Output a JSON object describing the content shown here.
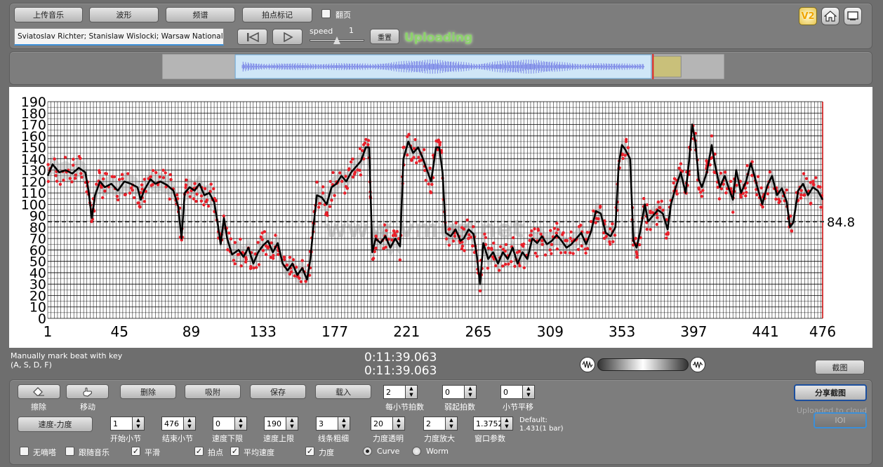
{
  "toolbar": {
    "upload_music": "上传音乐",
    "waveform": "波形",
    "spectrum": "频谱",
    "tap_mark": "拍点标记",
    "page_turn": "翻页",
    "track_title": "Sviatoslav Richter; Stanislaw Wislocki; Warsaw National Ph",
    "speed_label": "speed",
    "speed_value": "1",
    "speed_fraction": 0.5,
    "reset": "重置",
    "uploading": "Uploading",
    "version_badge": "V2"
  },
  "overview": {
    "selection_start": 0.13,
    "selection_end": 0.87,
    "marker_pos": 0.873
  },
  "chart_data": {
    "type": "line",
    "title": "",
    "xlabel": "",
    "ylabel": "",
    "xlim": [
      1,
      476
    ],
    "ylim": [
      0,
      190
    ],
    "xticks": [
      1,
      45,
      89,
      133,
      177,
      221,
      265,
      309,
      353,
      397,
      441,
      476
    ],
    "yticks": [
      0,
      10,
      20,
      30,
      40,
      50,
      60,
      70,
      80,
      90,
      100,
      110,
      120,
      130,
      140,
      150,
      160,
      170,
      180,
      190
    ],
    "average_line": 84.8,
    "average_label": "84.8",
    "grid": true,
    "watermark": "www.vmus.net",
    "series": [
      {
        "points": [
          [
            1,
            125
          ],
          [
            4,
            135
          ],
          [
            8,
            128
          ],
          [
            12,
            130
          ],
          [
            16,
            127
          ],
          [
            20,
            132
          ],
          [
            24,
            128
          ],
          [
            26,
            112
          ],
          [
            28,
            88
          ],
          [
            30,
            108
          ],
          [
            33,
            120
          ],
          [
            36,
            115
          ],
          [
            40,
            118
          ],
          [
            44,
            112
          ],
          [
            48,
            120
          ],
          [
            52,
            118
          ],
          [
            56,
            115
          ],
          [
            58,
            104
          ],
          [
            60,
            112
          ],
          [
            64,
            122
          ],
          [
            67,
            118
          ],
          [
            70,
            120
          ],
          [
            74,
            117
          ],
          [
            78,
            112
          ],
          [
            81,
            98
          ],
          [
            83,
            70
          ],
          [
            85,
            110
          ],
          [
            88,
            115
          ],
          [
            91,
            112
          ],
          [
            94,
            118
          ],
          [
            97,
            108
          ],
          [
            100,
            110
          ],
          [
            103,
            102
          ],
          [
            105,
            85
          ],
          [
            107,
            65
          ],
          [
            109,
            88
          ],
          [
            111,
            70
          ],
          [
            114,
            56
          ],
          [
            118,
            60
          ],
          [
            121,
            54
          ],
          [
            124,
            62
          ],
          [
            127,
            48
          ],
          [
            130,
            58
          ],
          [
            133,
            64
          ],
          [
            136,
            68
          ],
          [
            139,
            58
          ],
          [
            142,
            66
          ],
          [
            145,
            48
          ],
          [
            148,
            42
          ],
          [
            151,
            48
          ],
          [
            154,
            38
          ],
          [
            157,
            44
          ],
          [
            160,
            34
          ],
          [
            162,
            52
          ],
          [
            164,
            82
          ],
          [
            166,
            108
          ],
          [
            169,
            106
          ],
          [
            172,
            100
          ],
          [
            175,
            115
          ],
          [
            178,
            118
          ],
          [
            181,
            125
          ],
          [
            184,
            120
          ],
          [
            187,
            128
          ],
          [
            190,
            133
          ],
          [
            193,
            138
          ],
          [
            196,
            150
          ],
          [
            198,
            150
          ],
          [
            200,
            58
          ],
          [
            202,
            70
          ],
          [
            205,
            66
          ],
          [
            208,
            72
          ],
          [
            211,
            62
          ],
          [
            214,
            70
          ],
          [
            217,
            63
          ],
          [
            219,
            140
          ],
          [
            222,
            155
          ],
          [
            225,
            145
          ],
          [
            228,
            150
          ],
          [
            231,
            140
          ],
          [
            234,
            128
          ],
          [
            236,
            120
          ],
          [
            239,
            150
          ],
          [
            241,
            150
          ],
          [
            243,
            128
          ],
          [
            245,
            75
          ],
          [
            248,
            72
          ],
          [
            251,
            78
          ],
          [
            254,
            68
          ],
          [
            256,
            70
          ],
          [
            259,
            78
          ],
          [
            262,
            74
          ],
          [
            264,
            55
          ],
          [
            266,
            30
          ],
          [
            268,
            66
          ],
          [
            271,
            52
          ],
          [
            274,
            58
          ],
          [
            277,
            48
          ],
          [
            280,
            58
          ],
          [
            283,
            52
          ],
          [
            286,
            62
          ],
          [
            289,
            48
          ],
          [
            292,
            58
          ],
          [
            295,
            52
          ],
          [
            298,
            70
          ],
          [
            301,
            66
          ],
          [
            304,
            72
          ],
          [
            307,
            65
          ],
          [
            310,
            68
          ],
          [
            313,
            73
          ],
          [
            316,
            68
          ],
          [
            319,
            62
          ],
          [
            322,
            65
          ],
          [
            325,
            70
          ],
          [
            328,
            75
          ],
          [
            331,
            65
          ],
          [
            334,
            76
          ],
          [
            337,
            94
          ],
          [
            340,
            92
          ],
          [
            343,
            75
          ],
          [
            346,
            72
          ],
          [
            349,
            80
          ],
          [
            351,
            135
          ],
          [
            353,
            152
          ],
          [
            355,
            148
          ],
          [
            358,
            140
          ],
          [
            360,
            68
          ],
          [
            362,
            62
          ],
          [
            364,
            75
          ],
          [
            367,
            100
          ],
          [
            369,
            85
          ],
          [
            372,
            90
          ],
          [
            375,
            95
          ],
          [
            378,
            92
          ],
          [
            381,
            78
          ],
          [
            383,
            100
          ],
          [
            386,
            115
          ],
          [
            389,
            128
          ],
          [
            392,
            110
          ],
          [
            394,
            136
          ],
          [
            396,
            170
          ],
          [
            398,
            155
          ],
          [
            400,
            122
          ],
          [
            402,
            115
          ],
          [
            405,
            128
          ],
          [
            408,
            152
          ],
          [
            410,
            135
          ],
          [
            413,
            115
          ],
          [
            416,
            125
          ],
          [
            419,
            112
          ],
          [
            421,
            104
          ],
          [
            423,
            130
          ],
          [
            426,
            110
          ],
          [
            429,
            120
          ],
          [
            432,
            136
          ],
          [
            434,
            126
          ],
          [
            436,
            115
          ],
          [
            439,
            100
          ],
          [
            442,
            116
          ],
          [
            445,
            125
          ],
          [
            448,
            108
          ],
          [
            451,
            114
          ],
          [
            454,
            102
          ],
          [
            456,
            80
          ],
          [
            458,
            84
          ],
          [
            461,
            112
          ],
          [
            464,
            118
          ],
          [
            467,
            108
          ],
          [
            470,
            115
          ],
          [
            473,
            112
          ],
          [
            476,
            104
          ]
        ]
      }
    ]
  },
  "transport": {
    "hint_line1": "Manually mark beat with key",
    "hint_line2": "(A, S, D, F)",
    "time1": "0:11:39.063",
    "time2": "0:11:39.063",
    "screenshot": "截图"
  },
  "controls": {
    "erase": "擦除",
    "move": "移动",
    "delete": "删除",
    "absorb": "吸附",
    "save": "保存",
    "load": "载入",
    "beats_per_bar_label": "每小节拍数",
    "beats_per_bar_value": "2",
    "pickup_label": "弱起拍数",
    "pickup_value": "0",
    "bar_shift_label": "小节平移",
    "bar_shift_value": "0",
    "share_screenshot": "分享截图",
    "uploaded_to_cloud": "Uploaded to cloud",
    "ioi": "IOI",
    "tempo_dynamics": "速度-力度",
    "start_bar_label": "开始小节",
    "start_bar_value": "1",
    "end_bar_label": "结束小节",
    "end_bar_value": "476",
    "tempo_min_label": "速度下限",
    "tempo_min_value": "0",
    "tempo_max_label": "速度上限",
    "tempo_max_value": "190",
    "line_width_label": "线条粗细",
    "line_width_value": "3",
    "dyn_opacity_label": "力度透明",
    "dyn_opacity_value": "20",
    "dyn_zoom_label": "力度放大",
    "dyn_zoom_value": "2",
    "window_param_label": "窗口参数",
    "window_param_value": "1.3752",
    "default_line1": "Default:",
    "default_line2": "1.431(1 bar)",
    "no_beep": "无嘀嗒",
    "follow_music": "跟随音乐",
    "smooth": "平滑",
    "beat_points": "拍点",
    "avg_tempo": "平均速度",
    "dynamics": "力度",
    "curve": "Curve",
    "worm": "Worm"
  }
}
